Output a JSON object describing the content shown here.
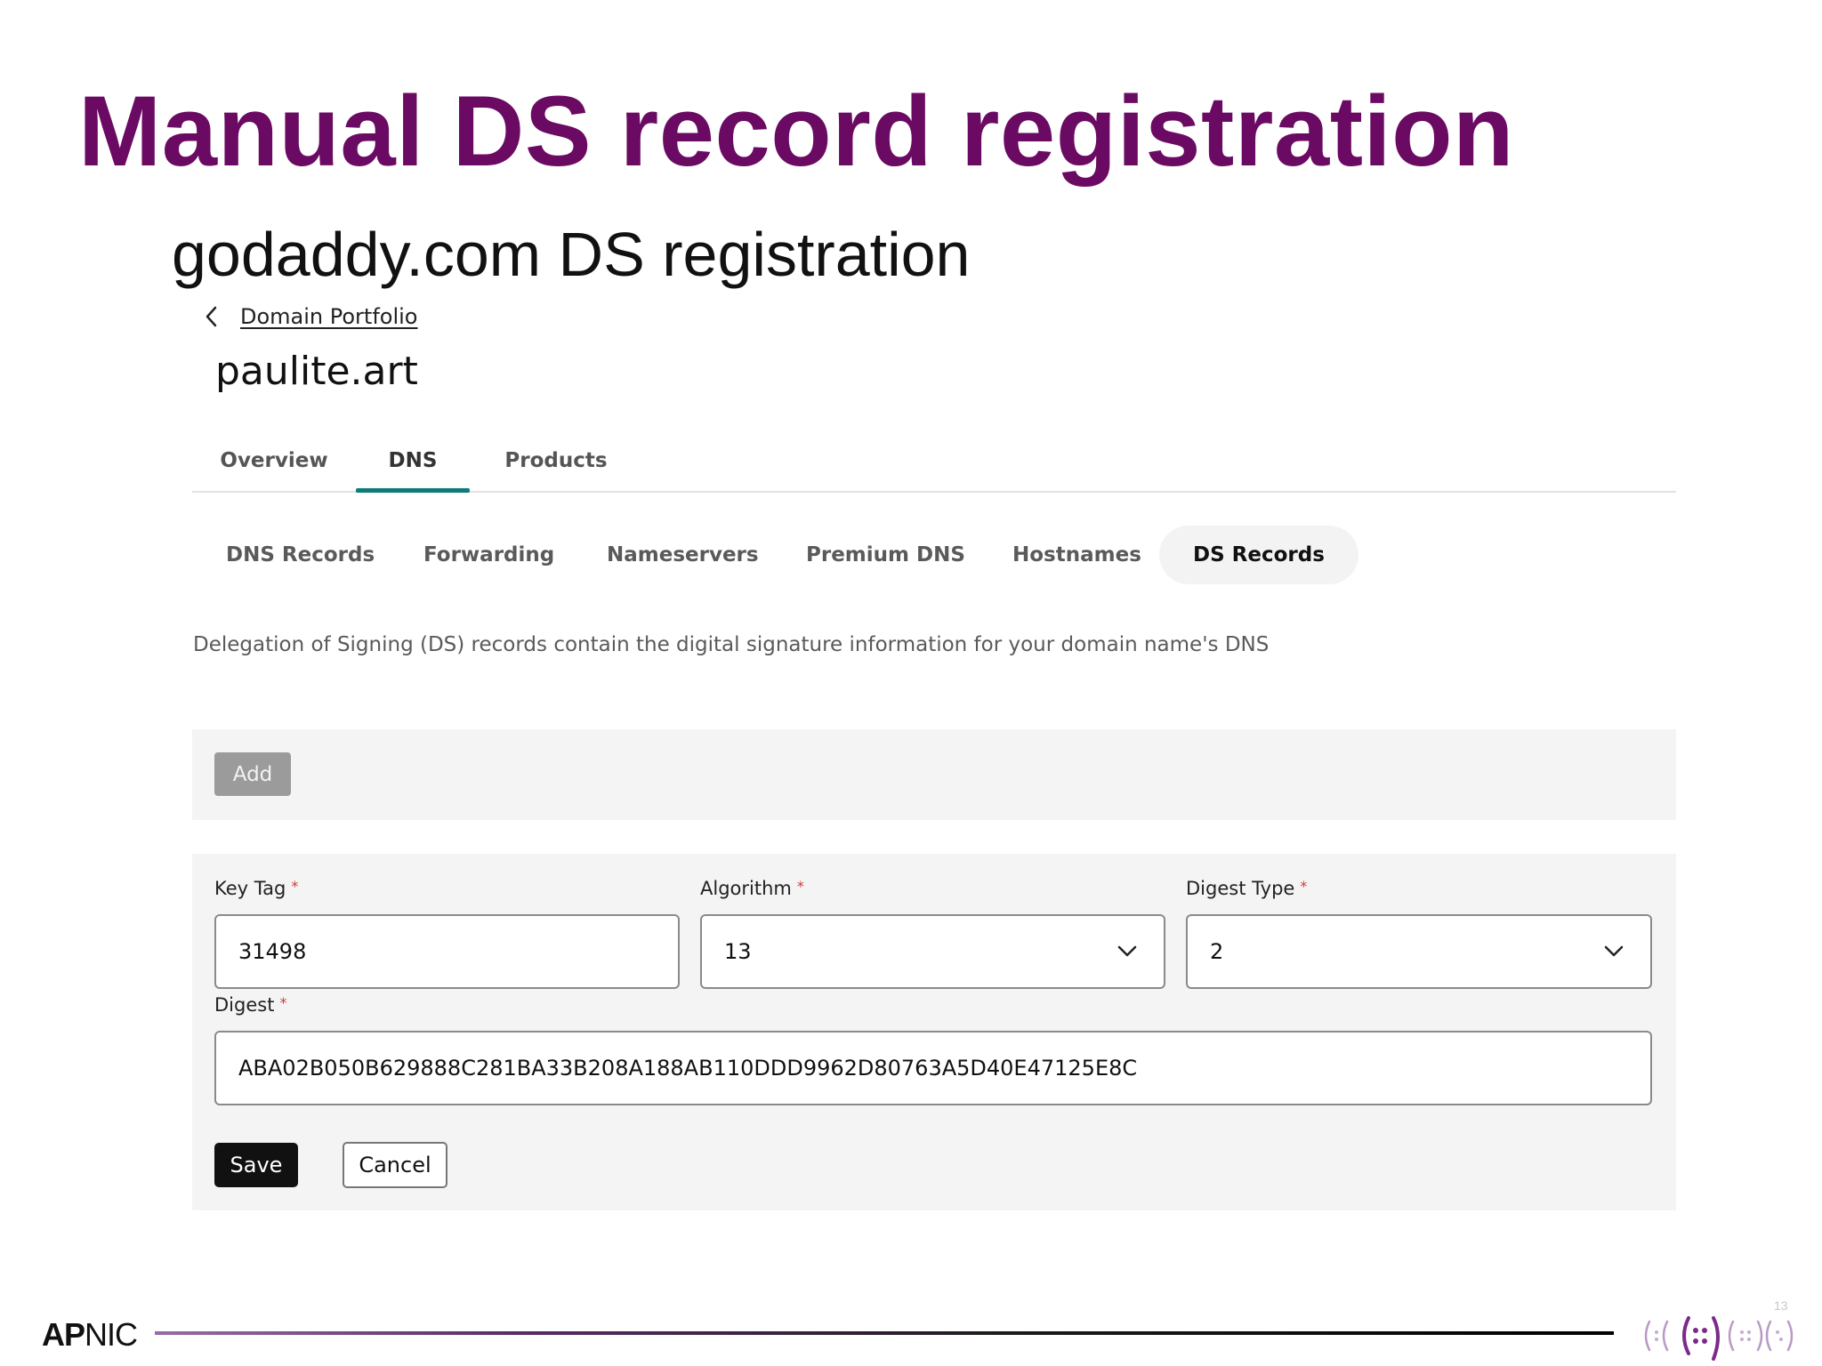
{
  "slide": {
    "title": "Manual DS record registration",
    "subtitle": "godaddy.com DS registration",
    "page_number": "13",
    "footer_logo": {
      "bold": "AP",
      "regular": "NIC"
    }
  },
  "breadcrumb": {
    "back_icon": "chevron-left-icon",
    "link": "Domain Portfolio"
  },
  "domain": "paulite.art",
  "main_tabs": [
    {
      "label": "Overview",
      "active": false
    },
    {
      "label": "DNS",
      "active": true
    },
    {
      "label": "Products",
      "active": false
    }
  ],
  "sub_tabs": [
    {
      "label": "DNS Records",
      "active": false
    },
    {
      "label": "Forwarding",
      "active": false
    },
    {
      "label": "Nameservers",
      "active": false
    },
    {
      "label": "Premium DNS",
      "active": false
    },
    {
      "label": "Hostnames",
      "active": false
    },
    {
      "label": "DS Records",
      "active": true
    }
  ],
  "description": "Delegation of Signing (DS) records contain the digital signature information for your domain name's DNS",
  "add_button": "Add",
  "form": {
    "key_tag": {
      "label": "Key Tag",
      "required_mark": "*",
      "value": "31498"
    },
    "algorithm": {
      "label": "Algorithm",
      "required_mark": "*",
      "value": "13",
      "icon": "chevron-down-icon"
    },
    "digest_type": {
      "label": "Digest Type",
      "required_mark": "*",
      "value": "2",
      "icon": "chevron-down-icon"
    },
    "digest": {
      "label": "Digest",
      "required_mark": "*",
      "value": "ABA02B050B629888C281BA33B208A188AB110DDD9962D80763A5D40E47125E8C"
    },
    "save": "Save",
    "cancel": "Cancel"
  },
  "colors": {
    "title": "#6b0a63",
    "tab_indicator": "#0f7a7a",
    "required": "#d23b2c",
    "save_bg": "#111111"
  }
}
